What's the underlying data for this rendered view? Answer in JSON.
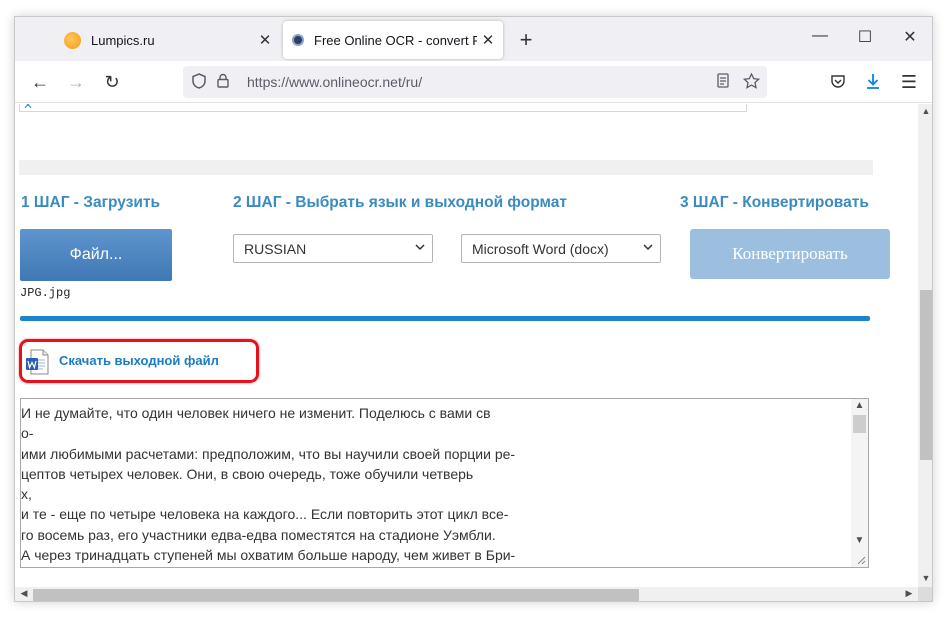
{
  "browser": {
    "tabs": [
      {
        "title": "Lumpics.ru",
        "favicon": "orange-circle-icon",
        "active": false
      },
      {
        "title": "Free Online OCR - convert PDF to",
        "favicon": "onlineocr-icon",
        "active": true
      }
    ],
    "new_tab_symbol": "+",
    "window_controls": {
      "minimize": "—",
      "maximize": "☐",
      "close": "✕"
    },
    "tab_close_symbol": "✕",
    "url": "https://www.onlineocr.net/ru/",
    "nav": {
      "back": "←",
      "forward": "→",
      "reload": "↻",
      "menu": "☰"
    }
  },
  "page": {
    "steps": {
      "step1": "1 ШАГ - Загрузить",
      "step2": "2 ШАГ - Выбрать язык и выходной формат",
      "step3": "3 ШАГ - Конвертировать"
    },
    "file_button_label": "Файл...",
    "file_name": "JPG.jpg",
    "language_select": "RUSSIAN",
    "format_select": "Microsoft Word (docx)",
    "convert_button_label": "Конвертировать",
    "download_link": "Скачать выходной файл",
    "partial_close": "✕",
    "result_lines": [
      "И не думайте, что один человек ничего не изменит. Поделюсь с вами св",
      "о-",
      "ими любимыми расчетами: предположим, что вы научили своей порции ре-",
      "цептов четырех человек. Они, в свою очередь, тоже обучили четверь",
      "х,",
      "и те - еще по четыре человека на каждого... Если повторить этот цикл все-",
      "го восемь раз, его участники едва-едва поместятся на стадионе Уэмбли.",
      "А через тринадцать ступеней мы охватим больше народу, чем живет в Бри-"
    ]
  },
  "colors": {
    "step_heading": "#3a8bbf",
    "file_button": "#4f86c3",
    "convert_button": "#9dbfdf",
    "progress_line": "#1a85c8",
    "highlight": "#e8101a",
    "link": "#1a7cc2"
  }
}
